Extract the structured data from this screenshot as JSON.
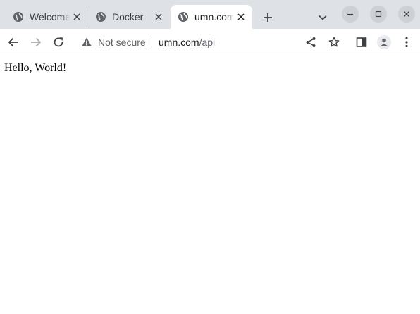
{
  "tabs": [
    {
      "title": "Welcome to nginx!",
      "favicon": "globe-icon",
      "active": false
    },
    {
      "title": "Docker",
      "favicon": "globe-icon",
      "active": false
    },
    {
      "title": "umn.com/api",
      "favicon": "globe-icon",
      "active": true
    }
  ],
  "omnibox": {
    "security_label": "Not secure",
    "url_host": "umn.com",
    "url_path": "/api"
  },
  "page": {
    "body_text": "Hello, World!"
  },
  "colors": {
    "tabstrip_bg": "#dee1e6",
    "active_tab_bg": "#ffffff",
    "icon": "#5f6368"
  }
}
